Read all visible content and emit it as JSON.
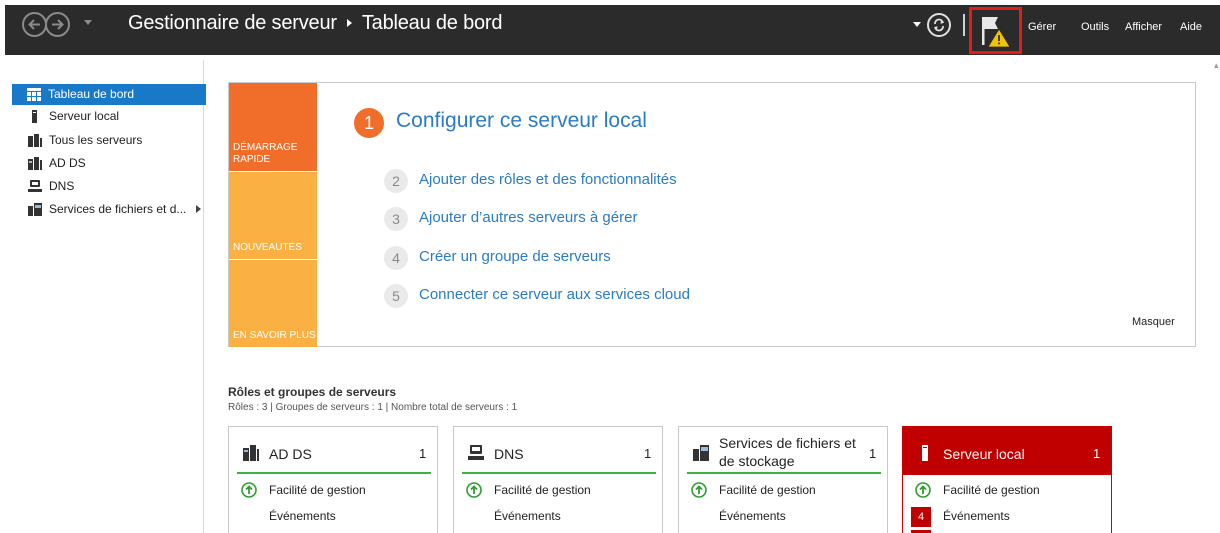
{
  "window": {
    "title": "Gestionnaire de serveur",
    "page": "Tableau de bord"
  },
  "menu": [
    "Gérer",
    "Outils",
    "Afficher",
    "Aide"
  ],
  "sidebar": {
    "items": [
      {
        "label": "Tableau de bord",
        "icon": "dashboard-icon",
        "active": true
      },
      {
        "label": "Serveur local",
        "icon": "server-icon"
      },
      {
        "label": "Tous les serveurs",
        "icon": "servers-icon"
      },
      {
        "label": "AD DS",
        "icon": "ad-ds-icon"
      },
      {
        "label": "DNS",
        "icon": "dns-icon"
      },
      {
        "label": "Services de fichiers et d...",
        "icon": "file-services-icon"
      }
    ]
  },
  "quick_start": {
    "tiles": [
      "DÉMARRAGE RAPIDE",
      "NOUVEAUTÉS",
      "EN SAVOIR PLUS"
    ],
    "steps": [
      {
        "num": "1",
        "label": "Configurer ce serveur local"
      },
      {
        "num": "2",
        "label": "Ajouter des rôles et des fonctionnalités"
      },
      {
        "num": "3",
        "label": "Ajouter d’autres serveurs à gérer"
      },
      {
        "num": "4",
        "label": "Créer un groupe de serveurs"
      },
      {
        "num": "5",
        "label": "Connecter ce serveur aux services cloud"
      }
    ],
    "hide_label": "Masquer"
  },
  "roles": {
    "title": "Rôles et groupes de serveurs",
    "summary": "Rôles : 3 | Groupes de serveurs : 1 | Nombre total de serveurs : 1",
    "cards": [
      {
        "name": "AD DS",
        "count": "1",
        "manageability": "Facilité de gestion",
        "events": "Événements"
      },
      {
        "name": "DNS",
        "count": "1",
        "manageability": "Facilité de gestion",
        "events": "Événements"
      },
      {
        "name_line1": "Services de fichiers et",
        "name_line2": "de stockage",
        "count": "1",
        "manageability": "Facilité de gestion",
        "events": "Événements"
      },
      {
        "name": "Serveur local",
        "count": "1",
        "manageability": "Facilité de gestion",
        "events": "Événements",
        "event_count": "4"
      }
    ]
  },
  "colors": {
    "header": "#2b2b2b",
    "accent_blue": "#1979c9",
    "quick_start_orange": "#f06e29",
    "tile_yellow": "#fbb044",
    "link_blue": "#2a7cc4",
    "alert_red": "#c00000",
    "ok_green": "#3cb33c"
  }
}
